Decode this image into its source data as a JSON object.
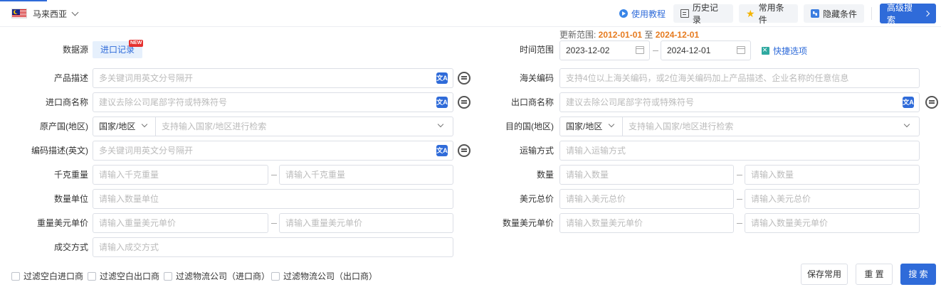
{
  "header": {
    "country": "马来西亚",
    "tutorial": "使用教程",
    "history": "历史记录",
    "favorites": "常用条件",
    "hide": "隐藏条件",
    "advanced": "高级搜索"
  },
  "range": {
    "prefix": "更新范围: ",
    "start": "2012-01-01",
    "sep": " 至 ",
    "end": "2024-12-01"
  },
  "form": {
    "source_label": "数据源",
    "source_value": "进口记录",
    "new_badge": "NEW",
    "time_label": "时间范围",
    "time_start": "2023-12-02",
    "time_end": "2024-12-01",
    "quick": "快捷选项",
    "product_label": "产品描述",
    "product_ph": "多关键词用英文分号隔开",
    "hs_label": "海关编码",
    "hs_ph": "支持4位以上海关编码，或2位海关编码加上产品描述、企业名称的任意信息",
    "importer_label": "进口商名称",
    "importer_ph": "建议去除公司尾部字符或特殊符号",
    "exporter_label": "出口商名称",
    "exporter_ph": "建议去除公司尾部字符或特殊符号",
    "origin_label": "原产国(地区)",
    "origin_type": "国家/地区",
    "origin_ph": "支持输入国家/地区进行检索",
    "dest_label": "目的国(地区)",
    "dest_type": "国家/地区",
    "dest_ph": "支持输入国家/地区进行检索",
    "code_desc_label": "编码描述(英文)",
    "code_desc_ph": "多关键词用英文分号隔开",
    "transport_label": "运输方式",
    "transport_ph": "请输入运输方式",
    "kg_label": "千克重量",
    "kg_ph": "请输入千克重量",
    "qty_label": "数量",
    "qty_ph": "请输入数量",
    "unit_label": "数量单位",
    "unit_ph": "请输入数量单位",
    "usd_total_label": "美元总价",
    "usd_total_ph": "请输入美元总价",
    "weight_price_label": "重量美元单价",
    "weight_price_ph": "请输入重量美元单价",
    "qty_price_label": "数量美元单价",
    "qty_price_ph": "请输入数量美元单价",
    "deal_label": "成交方式",
    "deal_ph": "请输入成交方式",
    "trans_icon_text": "文A"
  },
  "filters": [
    "过滤空白进口商",
    "过滤空白出口商",
    "过滤物流公司（进口商）",
    "过滤物流公司（出口商）"
  ],
  "actions": {
    "save": "保存常用",
    "reset": "重 置",
    "search": "搜 索"
  },
  "colors": {
    "primary": "#2f6bd9",
    "accent": "#e67a1e",
    "badge": "#e5312f"
  }
}
